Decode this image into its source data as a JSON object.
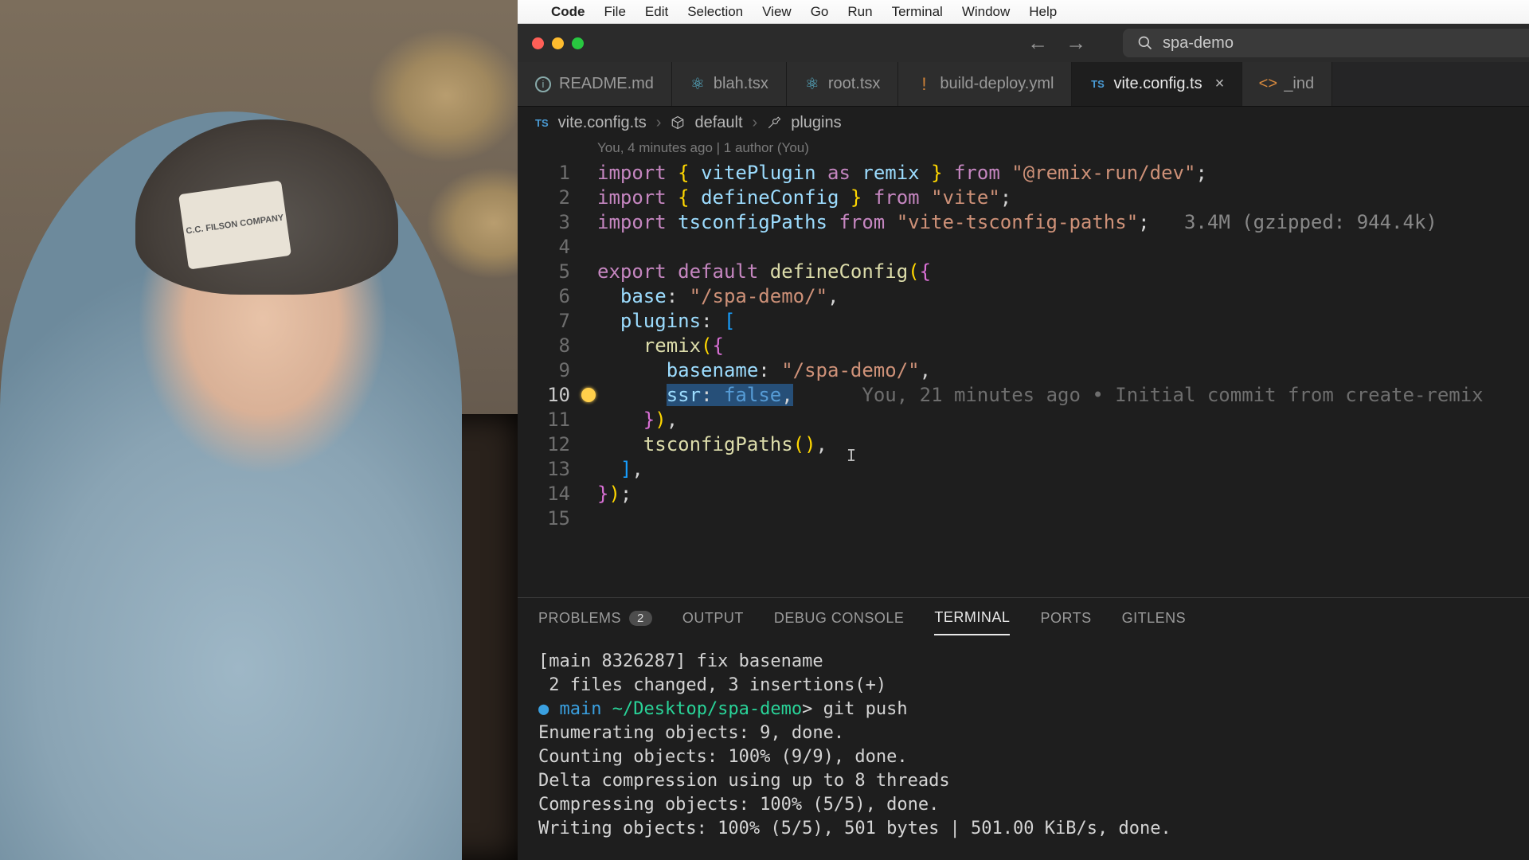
{
  "menubar": {
    "app": "Code",
    "items": [
      "File",
      "Edit",
      "Selection",
      "View",
      "Go",
      "Run",
      "Terminal",
      "Window",
      "Help"
    ]
  },
  "nav": {
    "back": "←",
    "forward": "→"
  },
  "search": {
    "text": "spa-demo"
  },
  "tabs": [
    {
      "icon": "info",
      "label": "README.md",
      "active": false
    },
    {
      "icon": "react",
      "label": "blah.tsx",
      "active": false
    },
    {
      "icon": "react",
      "label": "root.tsx",
      "active": false
    },
    {
      "icon": "yml",
      "label": "build-deploy.yml",
      "active": false
    },
    {
      "icon": "ts",
      "label": "vite.config.ts",
      "active": true,
      "close": true
    },
    {
      "icon": "html",
      "label": "_ind",
      "active": false
    }
  ],
  "breadcrumbs": {
    "file": "vite.config.ts",
    "segments": [
      "default",
      "plugins"
    ]
  },
  "codelens": "You, 4 minutes ago | 1 author (You)",
  "import_hint": "3.4M (gzipped: 944.4k)",
  "blame_line10": "You, 21 minutes ago • Initial commit from create-remix",
  "code": {
    "lines": 15,
    "current_line": 10,
    "base_value": "/spa-demo/",
    "basename_value": "/spa-demo/",
    "ssr_value": "false",
    "remix_pkg": "@remix-run/dev",
    "vite_pkg": "vite",
    "tsconfig_pkg": "vite-tsconfig-paths"
  },
  "panel": {
    "tabs": [
      {
        "label": "PROBLEMS",
        "badge": "2"
      },
      {
        "label": "OUTPUT"
      },
      {
        "label": "DEBUG CONSOLE"
      },
      {
        "label": "TERMINAL",
        "active": true
      },
      {
        "label": "PORTS"
      },
      {
        "label": "GITLENS"
      }
    ]
  },
  "terminal": {
    "commit_line": "[main 8326287] fix basename",
    "changed_line": " 2 files changed, 3 insertions(+)",
    "prompt_branch": "main",
    "prompt_path": "~/Desktop/spa-demo",
    "prompt_cmd": "git push",
    "out": [
      "Enumerating objects: 9, done.",
      "Counting objects: 100% (9/9), done.",
      "Delta compression using up to 8 threads",
      "Compressing objects: 100% (5/5), done.",
      "Writing objects: 100% (5/5), 501 bytes | 501.00 KiB/s, done."
    ]
  },
  "webcam_patch": "C.C. FILSON\nCOMPANY"
}
